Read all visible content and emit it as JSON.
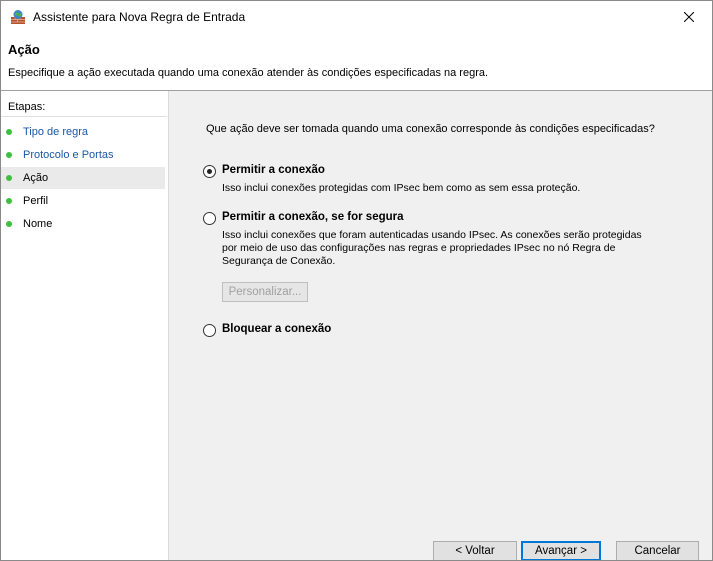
{
  "window": {
    "title": "Assistente para Nova Regra de Entrada"
  },
  "header": {
    "title": "Ação",
    "description": "Especifique a ação executada quando uma conexão atender às condições especificadas na regra."
  },
  "sidebar": {
    "heading": "Etapas:",
    "steps": [
      {
        "label": "Tipo de regra"
      },
      {
        "label": "Protocolo e Portas"
      },
      {
        "label": "Ação"
      },
      {
        "label": "Perfil"
      },
      {
        "label": "Nome"
      }
    ]
  },
  "main": {
    "question": "Que ação deve ser tomada quando uma conexão corresponde às condições especificadas?",
    "options": [
      {
        "label": "Permitir a conexão",
        "description": "Isso inclui conexões protegidas com IPsec bem como as sem essa proteção.",
        "selected": true
      },
      {
        "label": "Permitir a conexão, se for segura",
        "description": "Isso inclui conexões que foram autenticadas usando IPsec. As conexões serão protegidas por meio de uso das configurações nas regras e propriedades IPsec no nó Regra de Segurança de Conexão.",
        "selected": false
      },
      {
        "label": "Bloquear a conexão",
        "description": "",
        "selected": false
      }
    ],
    "customize_label": "Personalizar..."
  },
  "footer": {
    "back_label": "< Voltar",
    "next_label": "Avançar >",
    "cancel_label": "Cancelar"
  },
  "colors": {
    "step_dot": "#3fbf3f",
    "link": "#1a58a6",
    "content_bg": "#f0f0f0",
    "focus_border": "#0078d7"
  }
}
